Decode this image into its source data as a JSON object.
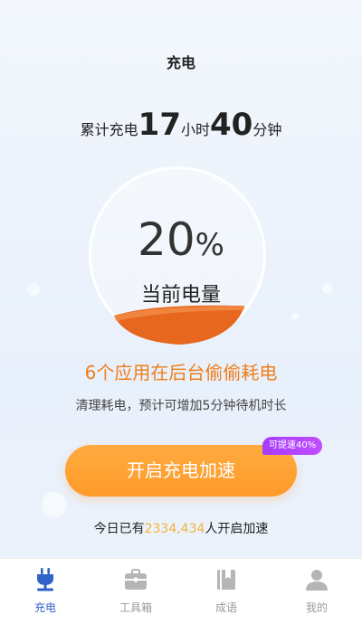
{
  "header": {
    "title": "充电"
  },
  "total_charge": {
    "prefix": "累计充电",
    "hours": "17",
    "hours_unit": "小时",
    "minutes": "40",
    "minutes_unit": "分钟"
  },
  "battery": {
    "level_percent": 20,
    "value": "20",
    "unit": "%",
    "label": "当前电量"
  },
  "warning": "6个应用在后台偷偷耗电",
  "hint": "清理耗电，预计可增加5分钟待机时长",
  "boost": {
    "button_label": "开启充电加速",
    "badge": "可提速40%"
  },
  "today": {
    "prefix": "今日已有",
    "count": "2334,434",
    "suffix": "人开启加速"
  },
  "tabbar": {
    "tabs": [
      {
        "label": "充电",
        "icon": "plug-icon",
        "active": true
      },
      {
        "label": "工具箱",
        "icon": "toolbox-icon",
        "active": false
      },
      {
        "label": "成语",
        "icon": "book-icon",
        "active": false
      },
      {
        "label": "我的",
        "icon": "user-icon",
        "active": false
      }
    ]
  },
  "colors": {
    "accent_blue": "#2f63c6",
    "orange": "#f07d1a",
    "button_orange": "#ff9a2a",
    "badge_purple": "#b142ff",
    "count_yellow": "#f2b43a",
    "wave_orange": "#e8671e"
  }
}
